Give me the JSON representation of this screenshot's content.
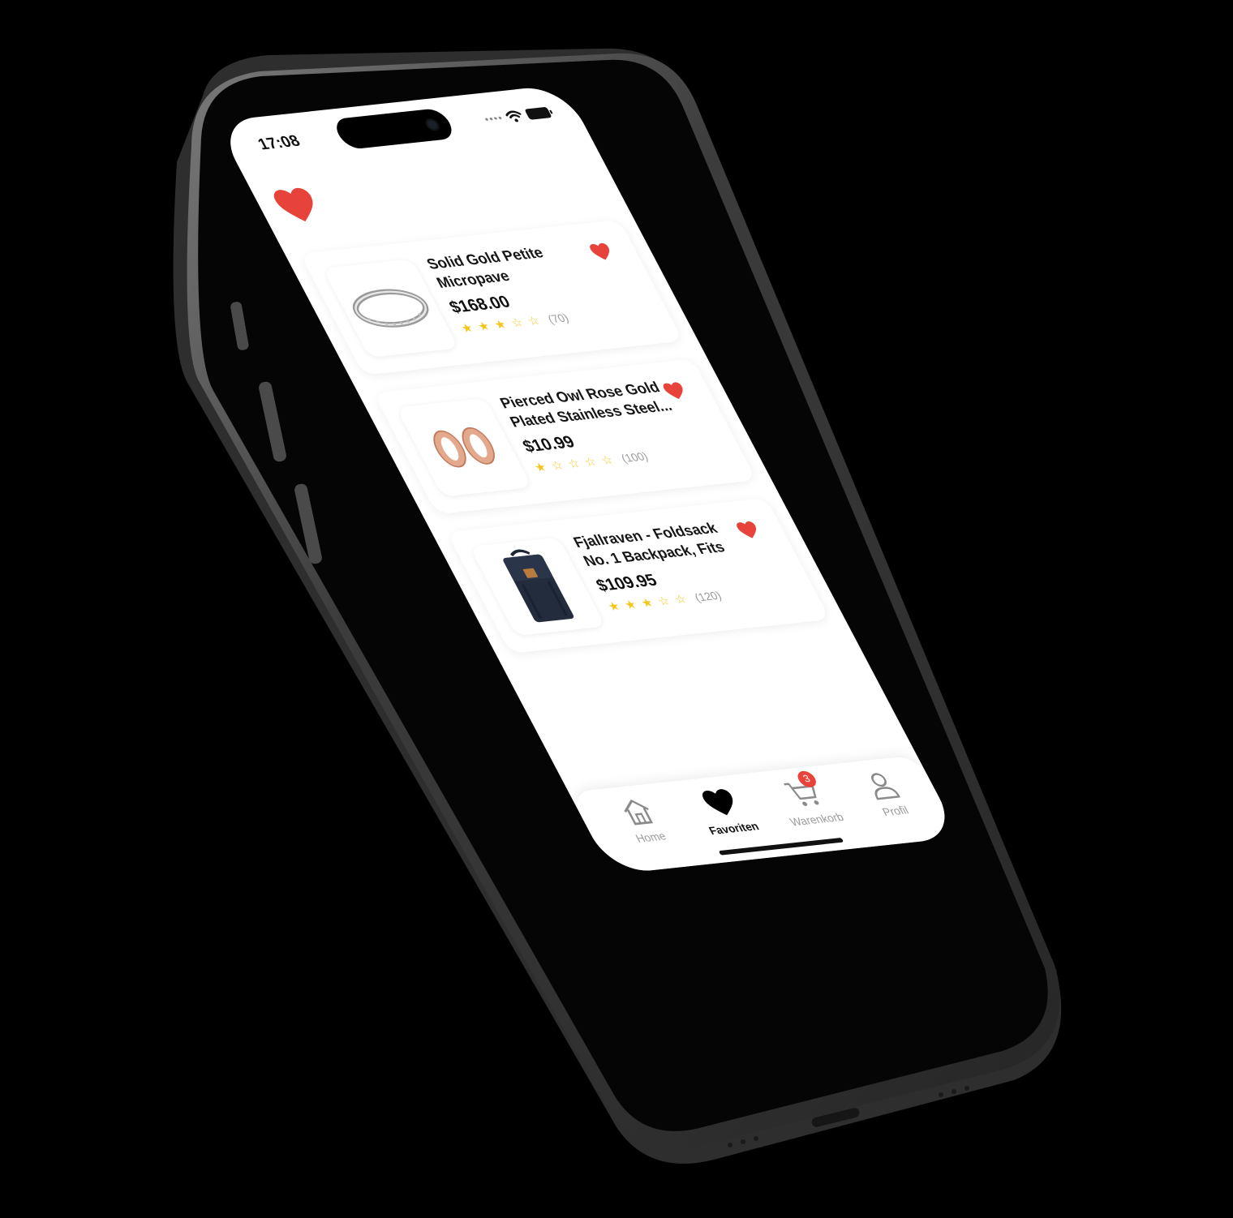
{
  "status_bar": {
    "time": "17:08"
  },
  "header": {
    "icon": "heart-icon",
    "color": "#e7433b"
  },
  "favorites": [
    {
      "title": "Solid Gold Petite Micropave",
      "price": "$168.00",
      "rating": 3,
      "count": "(70)",
      "image": "ring-icon"
    },
    {
      "title": "Pierced Owl Rose Gold Plated Stainless Steel...",
      "price": "$10.99",
      "rating": 1,
      "count": "(100)",
      "image": "earrings-icon"
    },
    {
      "title": "Fjallraven - Foldsack No. 1 Backpack, Fits 1...",
      "price": "$109.95",
      "rating": 3,
      "count": "(120)",
      "image": "backpack-icon"
    }
  ],
  "tabbar": {
    "home": "Home",
    "favorites": "Favoriten",
    "cart": "Warenkorb",
    "cart_badge": "3",
    "profile": "Profil"
  }
}
